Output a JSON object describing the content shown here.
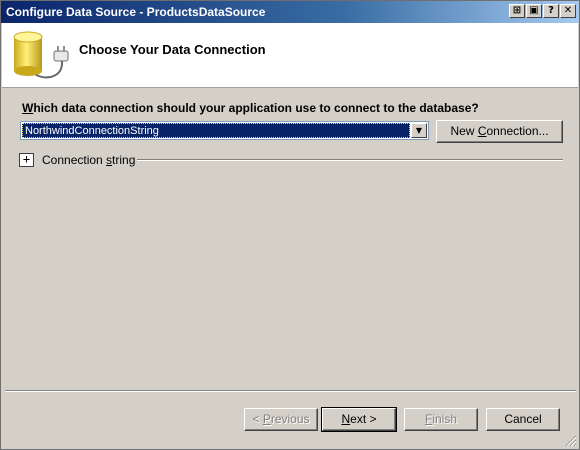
{
  "window": {
    "title": "Configure Data Source - ProductsDataSource",
    "controls": [
      "pin-icon",
      "restore-icon",
      "help-icon",
      "close-icon"
    ]
  },
  "header": {
    "title": "Choose Your Data Connection",
    "icon": "database-icon"
  },
  "main": {
    "question_prefix": "W",
    "question_rest": "hich data connection should your application use to connect to the database?",
    "connection_selected": "NorthwindConnectionString",
    "new_connection_prefix": "New ",
    "new_connection_underlined": "C",
    "new_connection_rest": "onnection...",
    "expander_symbol": "+",
    "connection_string_prefix": "Connection ",
    "connection_string_underlined": "s",
    "connection_string_rest": "tring"
  },
  "footer": {
    "previous_prefix": "< ",
    "previous_underlined": "P",
    "previous_rest": "revious",
    "next_underlined": "N",
    "next_rest": "ext >",
    "finish_underlined": "F",
    "finish_rest": "inish",
    "cancel_label": "Cancel"
  },
  "colors": {
    "title_bar_start": "#0a246a",
    "selection": "#0a246a",
    "dialog_face": "#d4d0c8"
  }
}
